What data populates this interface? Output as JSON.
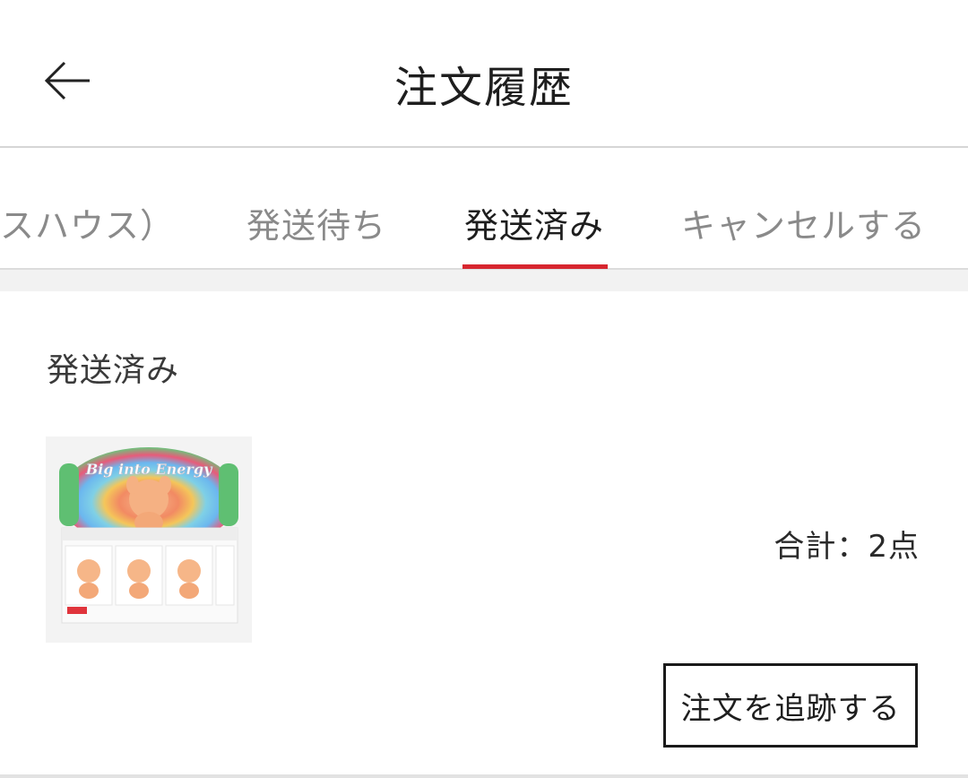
{
  "header": {
    "title": "注文履歴",
    "back_icon": "arrow-left-icon"
  },
  "tabs": [
    {
      "label": "スハウス）",
      "active": false
    },
    {
      "label": "発送待ち",
      "active": false
    },
    {
      "label": "発送済み",
      "active": true
    },
    {
      "label": "キャンセルする",
      "active": false
    }
  ],
  "colors": {
    "accent": "#d7262f",
    "tab_inactive": "#8a8a8a",
    "text": "#1e1e1e"
  },
  "order": {
    "status": "発送済み",
    "product_image_text": "Big into Energy",
    "total": "合計：2点",
    "track_button_label": "注文を追跡する"
  }
}
